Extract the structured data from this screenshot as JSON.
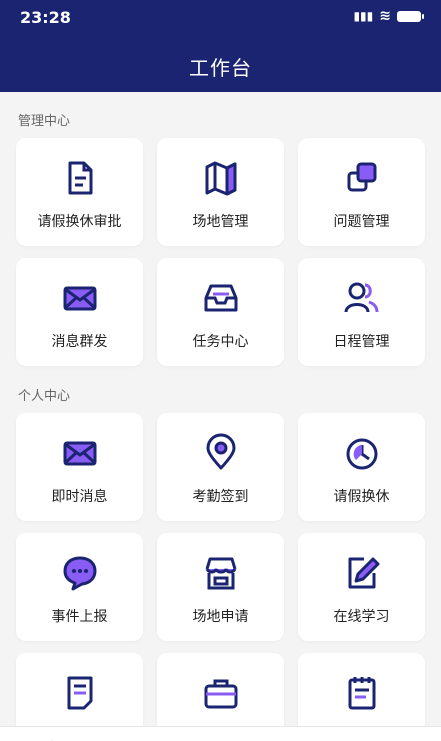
{
  "status": {
    "time": "23:28",
    "signal": "ull"
  },
  "header": {
    "title": "工作台"
  },
  "sections": {
    "manage": "管理中心",
    "personal": "个人中心"
  },
  "manage_items": [
    {
      "label": "请假换休审批",
      "icon": "document-icon"
    },
    {
      "label": "场地管理",
      "icon": "map-icon"
    },
    {
      "label": "问题管理",
      "icon": "copy-icon"
    },
    {
      "label": "消息群发",
      "icon": "mail-icon"
    },
    {
      "label": "任务中心",
      "icon": "inbox-icon"
    },
    {
      "label": "日程管理",
      "icon": "users-icon"
    }
  ],
  "personal_items": [
    {
      "label": "即时消息",
      "icon": "mail-icon"
    },
    {
      "label": "考勤签到",
      "icon": "location-icon"
    },
    {
      "label": "请假换休",
      "icon": "clock-icon"
    },
    {
      "label": "事件上报",
      "icon": "chat-icon"
    },
    {
      "label": "场地申请",
      "icon": "store-icon"
    },
    {
      "label": "在线学习",
      "icon": "edit-icon"
    },
    {
      "label": "",
      "icon": "form-icon"
    },
    {
      "label": "",
      "icon": "briefcase-icon"
    },
    {
      "label": "",
      "icon": "notepad-icon"
    }
  ],
  "colors": {
    "primary": "#1b2470",
    "accent": "#8a5cf6"
  }
}
